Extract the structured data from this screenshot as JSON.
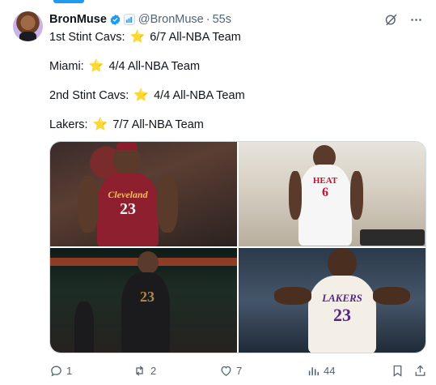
{
  "tweet": {
    "author": {
      "name": "BronMuse",
      "handle": "@BronMuse",
      "separator": "·",
      "time": "55s"
    },
    "lines": [
      {
        "label": "1st Stint Cavs:",
        "value": "6/7 All-NBA Team"
      },
      {
        "label": "Miami:",
        "value": "4/4 All-NBA Team"
      },
      {
        "label": "2nd Stint Cavs:",
        "value": "4/4 All-NBA Team"
      },
      {
        "label": "Lakers:",
        "value": "7/7 All-NBA Team"
      }
    ],
    "star_glyph": "⭐",
    "media": [
      {
        "jersey": "Cleveland",
        "number": "23"
      },
      {
        "jersey": "HEAT",
        "number": "6"
      },
      {
        "jersey": "",
        "number": "23"
      },
      {
        "jersey": "LAKERS",
        "number": "23"
      }
    ],
    "actions": {
      "replies": "1",
      "reposts": "2",
      "likes": "7",
      "views": "44"
    }
  },
  "colors": {
    "accent": "#1d9bf0",
    "text_primary": "#0f1419",
    "text_secondary": "#536471",
    "star": "#f5b400"
  },
  "icons": [
    "verified-badge-icon",
    "affiliate-badge-icon",
    "grok-icon",
    "more-icon",
    "reply-icon",
    "repost-icon",
    "like-icon",
    "views-icon",
    "bookmark-icon",
    "share-icon"
  ]
}
